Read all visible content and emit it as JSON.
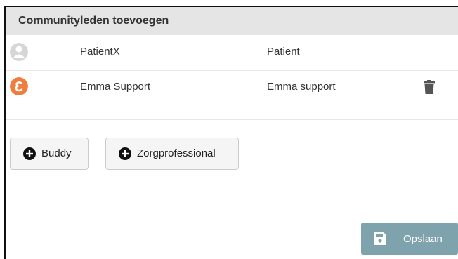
{
  "panel": {
    "title": "Communityleden toevoegen"
  },
  "members": [
    {
      "name": "PatientX",
      "role": "Patient",
      "avatar_icon": "person-placeholder-icon",
      "deletable": false
    },
    {
      "name": "Emma Support",
      "role": "Emma support",
      "avatar_icon": "emma-logo-icon",
      "deletable": true,
      "avatar_color": "#f07c3e"
    }
  ],
  "buttons": {
    "add_buddy": "Buddy",
    "add_professional": "Zorgprofessional",
    "save": "Opslaan"
  },
  "colors": {
    "header_bg": "#e5e5e5",
    "save_button": "#7fa3ad",
    "emma_orange": "#f07c3e"
  }
}
